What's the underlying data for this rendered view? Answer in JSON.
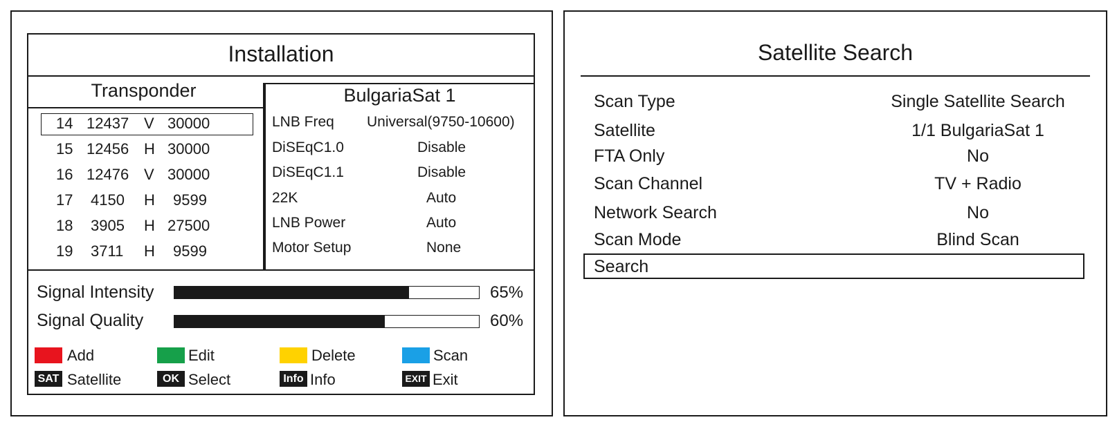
{
  "installation": {
    "title": "Installation",
    "transponder_header": "Transponder",
    "transponders": [
      {
        "no": "14",
        "freq": "12437",
        "pol": "V",
        "sr": "30000"
      },
      {
        "no": "15",
        "freq": "12456",
        "pol": "H",
        "sr": "30000"
      },
      {
        "no": "16",
        "freq": "12476",
        "pol": "V",
        "sr": "30000"
      },
      {
        "no": "17",
        "freq": "4150",
        "pol": "H",
        "sr": "9599"
      },
      {
        "no": "18",
        "freq": "3905",
        "pol": "H",
        "sr": "27500"
      },
      {
        "no": "19",
        "freq": "3711",
        "pol": "H",
        "sr": "9599"
      }
    ],
    "selected_transponder_index": 0,
    "satellite_name": "BulgariaSat 1",
    "params": [
      {
        "label": "LNB Freq",
        "value": "Universal(9750-10600)"
      },
      {
        "label": "DiSEqC1.0",
        "value": "Disable"
      },
      {
        "label": "DiSEqC1.1",
        "value": "Disable"
      },
      {
        "label": "22K",
        "value": "Auto"
      },
      {
        "label": "LNB Power",
        "value": "Auto"
      },
      {
        "label": "Motor Setup",
        "value": "None"
      }
    ],
    "signal_intensity": {
      "label": "Signal Intensity",
      "percent_text": "65%",
      "level": 0.77
    },
    "signal_quality": {
      "label": "Signal Quality",
      "percent_text": "60%",
      "level": 0.69
    },
    "color_keys": [
      {
        "color": "#e8141e",
        "label": "Add",
        "icon": "red-key-icon"
      },
      {
        "color": "#16a04a",
        "label": "Edit",
        "icon": "green-key-icon"
      },
      {
        "color": "#ffd200",
        "label": "Delete",
        "icon": "yellow-key-icon"
      },
      {
        "color": "#1aa0e6",
        "label": "Scan",
        "icon": "blue-key-icon"
      }
    ],
    "button_keys": [
      {
        "key": "SAT",
        "label": "Satellite"
      },
      {
        "key": "OK",
        "label": "Select"
      },
      {
        "key": "Info",
        "label": "Info"
      },
      {
        "key": "EXIT",
        "label": "Exit"
      }
    ]
  },
  "satellite_search": {
    "title": "Satellite Search",
    "items": [
      {
        "label": "Scan Type",
        "value": "Single Satellite Search"
      },
      {
        "label": "Satellite",
        "value": "1/1 BulgariaSat 1"
      },
      {
        "label": "FTA Only",
        "value": "No"
      },
      {
        "label": "Scan Channel",
        "value": "TV + Radio"
      },
      {
        "label": "Network Search",
        "value": "No"
      },
      {
        "label": "Scan Mode",
        "value": "Blind Scan"
      }
    ],
    "search_label": "Search"
  }
}
